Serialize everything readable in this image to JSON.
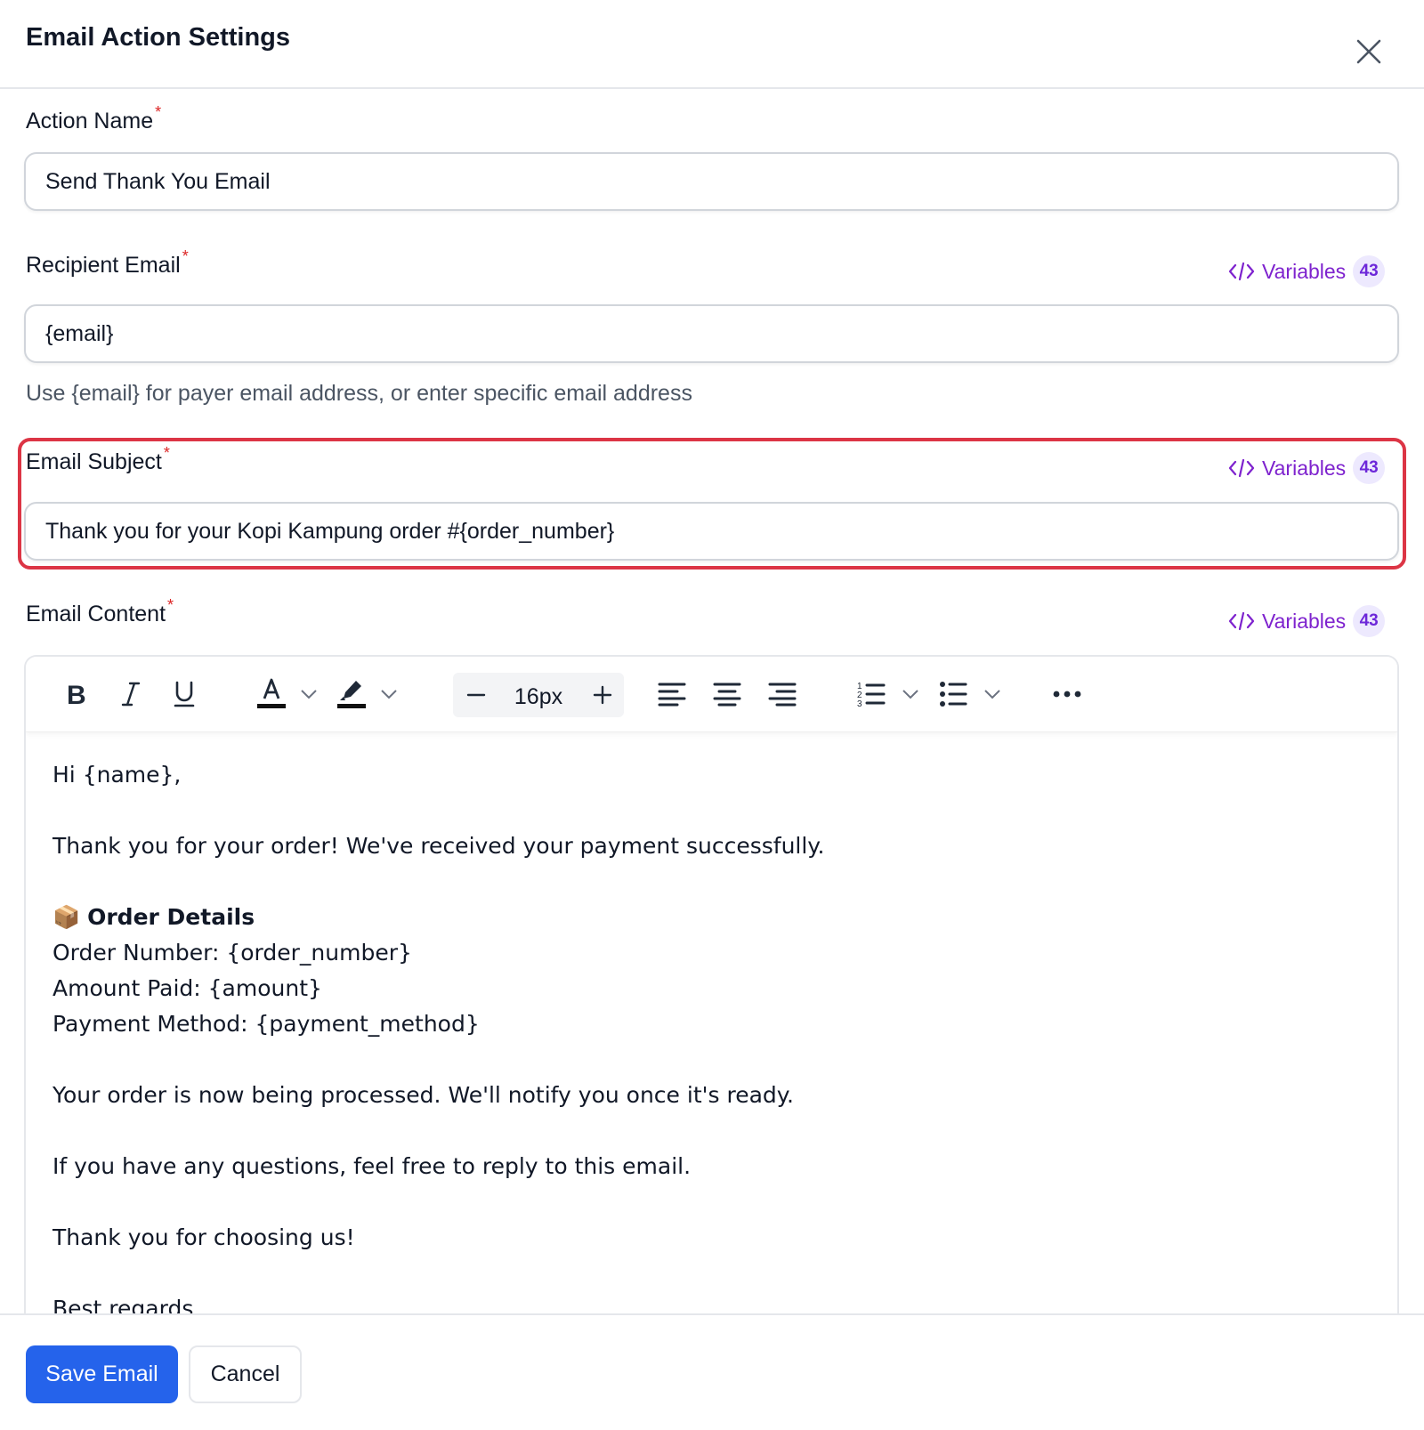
{
  "dialog": {
    "title": "Email Action Settings",
    "close_icon": "close-icon"
  },
  "fields": {
    "action_name": {
      "label": "Action Name",
      "required_mark": "*",
      "value": "Send Thank You Email"
    },
    "recipient_email": {
      "label": "Recipient Email",
      "required_mark": "*",
      "value": "{email}",
      "hint": "Use {email} for payer email address, or enter specific email address"
    },
    "email_subject": {
      "label": "Email Subject",
      "required_mark": "*",
      "value": "Thank you for your Kopi Kampung order #{order_number}"
    },
    "email_content": {
      "label": "Email Content",
      "required_mark": "*"
    }
  },
  "variables": {
    "label": "Variables",
    "count": "43",
    "icon": "code-icon",
    "color": "#7e22ce"
  },
  "toolbar": {
    "icons": [
      "bold-icon",
      "italic-icon",
      "underline-icon",
      "text-color-icon",
      "highlight-icon",
      "decrease-font-icon",
      "increase-font-icon",
      "align-left-icon",
      "align-center-icon",
      "align-right-icon",
      "ordered-list-icon",
      "bullet-list-icon",
      "more-icon"
    ],
    "font_size": "16px"
  },
  "content": {
    "line1": "Hi {name},",
    "line2": "Thank you for your order! We've received your payment successfully.",
    "order_icon": "📦",
    "order_heading": "Order Details",
    "order_number": "Order Number: {order_number}",
    "amount_paid": "Amount Paid: {amount}",
    "payment_method": "Payment Method: {payment_method}",
    "line3": "Your order is now being processed. We'll notify you once it's ready.",
    "line4": "If you have any questions, feel free to reply to this email.",
    "line5": "Thank you for choosing us!",
    "line6": "Best regards,"
  },
  "footer": {
    "save_label": "Save Email",
    "cancel_label": "Cancel"
  },
  "colors": {
    "primary": "#2563eb",
    "required": "#dc2626",
    "highlight_border": "#dc3545",
    "variables_badge_bg": "#ede9fe"
  }
}
